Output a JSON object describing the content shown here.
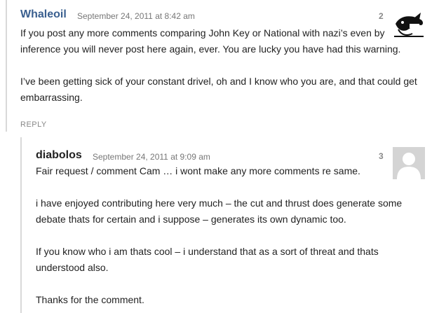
{
  "comments": [
    {
      "author": "Whaleoil",
      "date": "September 24, 2011 at 8:42 am",
      "number": "2",
      "paragraphs": [
        "If you post any more comments comparing John Key or National with nazi’s even by inference you will never post here again, ever. You are lucky you have had this warning.",
        "I’ve been getting sick of your constant drivel, oh and I know who you are, and that could get embarrassing."
      ],
      "reply_label": "REPLY",
      "avatar_icon": "whaleoil-logo-icon"
    },
    {
      "author": "diabolos",
      "date": "September 24, 2011 at 9:09 am",
      "number": "3",
      "paragraphs": [
        "Fair request / comment Cam … i wont make any more comments re same.",
        "i have enjoyed contributing here very much – the cut and thrust does generate some debate thats for certain and i suppose – generates its own dynamic too.",
        "If you know who i am thats cool – i understand that as a sort of threat and thats understood also.",
        "Thanks for the comment."
      ],
      "avatar_icon": "default-user-avatar-icon"
    }
  ],
  "colors": {
    "author_link": "#3a5f8f",
    "thread_border": "#d9d9d9",
    "meta_text": "#777777"
  }
}
